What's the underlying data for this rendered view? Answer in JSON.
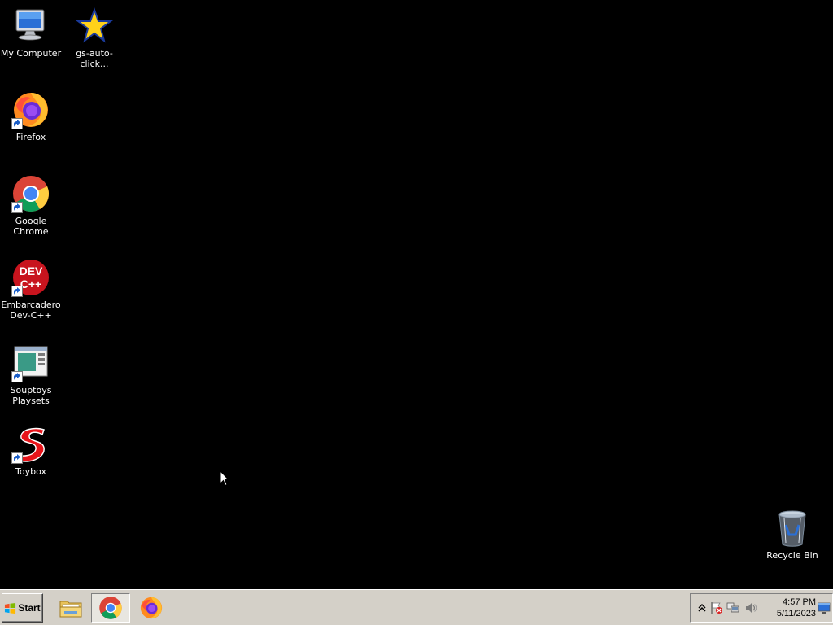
{
  "desktop": {
    "background": "#000000",
    "icons": [
      {
        "label": "My Computer",
        "icon": "computer-icon"
      },
      {
        "label": "gs-auto-click...",
        "icon": "star-icon"
      },
      {
        "label": "Firefox",
        "icon": "firefox-icon"
      },
      {
        "label": "Google Chrome",
        "icon": "chrome-icon"
      },
      {
        "label": "Embarcadero\nDev-C++",
        "icon": "devcpp-icon"
      },
      {
        "label": "Souptoys\nPlaysets",
        "icon": "souptoys-icon"
      },
      {
        "label": "Toybox",
        "icon": "toybox-icon"
      },
      {
        "label": "Recycle Bin",
        "icon": "recycle-bin-icon"
      }
    ]
  },
  "taskbar": {
    "start_label": "Start",
    "pinned": [
      {
        "name": "Windows Explorer",
        "icon": "explorer-icon",
        "active": false
      },
      {
        "name": "Google Chrome",
        "icon": "chrome-icon",
        "active": true
      },
      {
        "name": "Firefox",
        "icon": "firefox-icon",
        "active": false
      }
    ],
    "tray": {
      "icons": [
        "chevron-up-icon",
        "action-center-flag-icon",
        "network-icon",
        "volume-icon"
      ],
      "time": "4:57 PM",
      "date": "5/11/2023"
    }
  }
}
